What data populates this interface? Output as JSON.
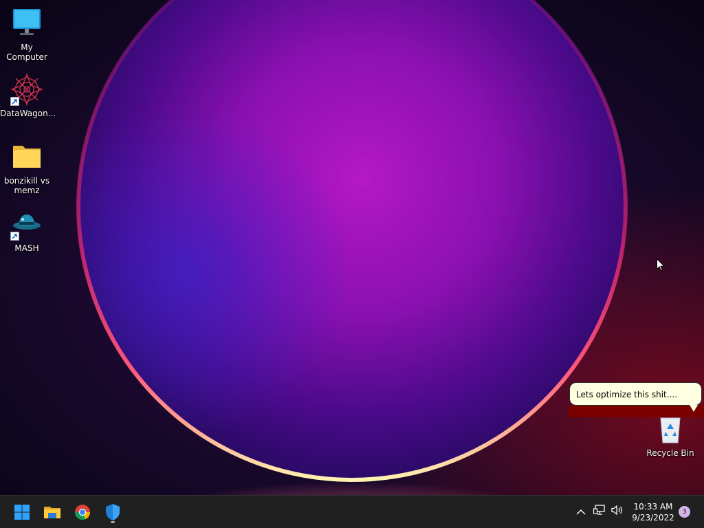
{
  "desktop": {
    "icons": [
      {
        "label": "My Computer",
        "icon": "computer-icon",
        "shortcut": false
      },
      {
        "label": "DataWagon...",
        "icon": "datawagon-icon",
        "shortcut": true
      },
      {
        "label": "bonzikill vs memz",
        "icon": "folder-icon",
        "shortcut": false
      },
      {
        "label": "MASH",
        "icon": "mash-hat-icon",
        "shortcut": true
      },
      {
        "label": "Recycle Bin",
        "icon": "recycle-bin-icon",
        "shortcut": false
      }
    ]
  },
  "speech_bubble": {
    "text": "Lets optimize this shit...."
  },
  "taskbar": {
    "pinned": [
      {
        "name": "start",
        "icon": "windows-start-icon"
      },
      {
        "name": "file-explorer",
        "icon": "file-explorer-icon"
      },
      {
        "name": "chrome",
        "icon": "chrome-icon"
      },
      {
        "name": "windows-security",
        "icon": "shield-icon",
        "running": true
      }
    ],
    "tray": {
      "icons": [
        "chevron-up-icon",
        "network-icon",
        "volume-icon"
      ],
      "time": "10:33 AM",
      "date": "9/23/2022",
      "notifications": "3"
    }
  },
  "colors": {
    "taskbar_bg": "#202020",
    "bubble_bg": "#ffffe1",
    "accent_blue": "#0078d4",
    "wallpaper_glow": "#b317c4"
  }
}
